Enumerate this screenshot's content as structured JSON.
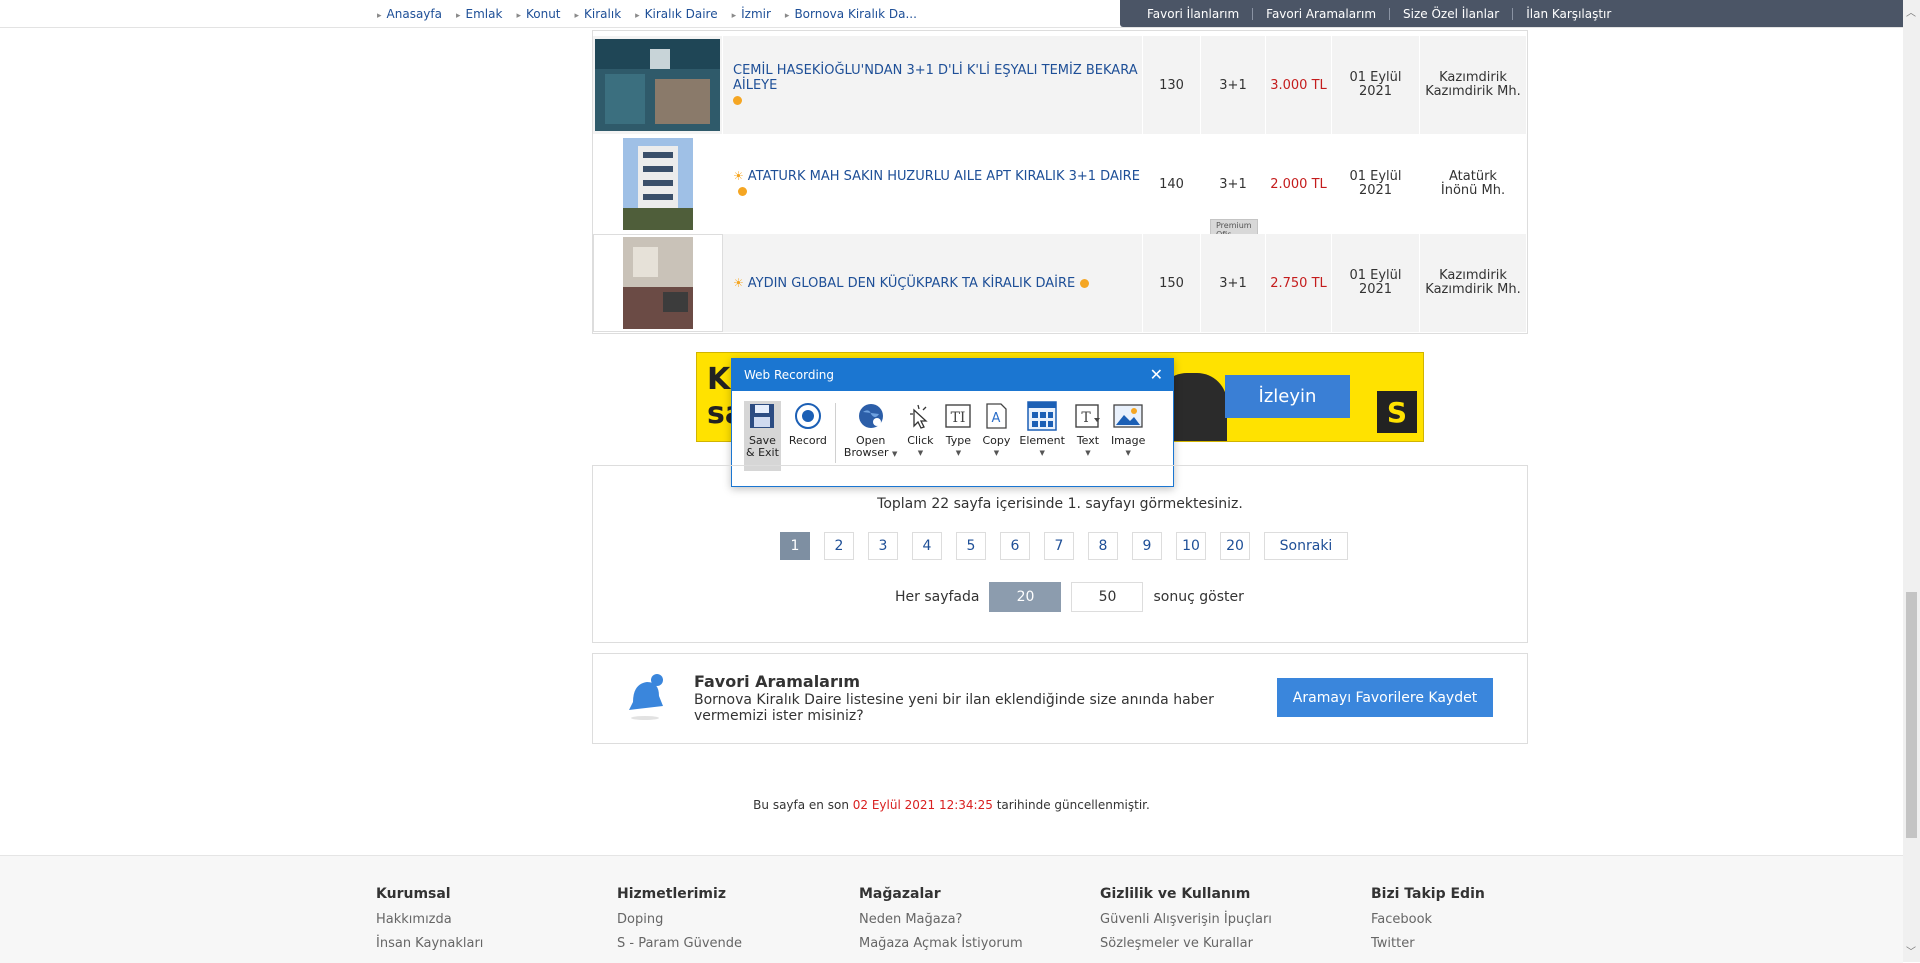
{
  "breadcrumbs": [
    "Anasayfa",
    "Emlak",
    "Konut",
    "Kiralık",
    "Kiralık Daire",
    "İzmir",
    "Bornova Kiralık Da..."
  ],
  "top_links": [
    "Favori İlanlarım",
    "Favori Aramalarım",
    "Size Özel İlanlar",
    "İlan Karşılaştır"
  ],
  "listings": [
    {
      "title": "CEMİL HASEKİOĞLU'NDAN 3+1 D'Lİ K'Lİ EŞYALI TEMİZ BEKARA AİLEYE",
      "m2": "130",
      "rooms": "3+1",
      "price": "3.000 TL",
      "date_line1": "01 Eylül",
      "date_line2": "2021",
      "loc_line1": "Kazımdirik",
      "loc_line2": "Kazımdirik Mh."
    },
    {
      "title": "ATATURK MAH SAKIN HUZURLU AILE APT KIRALIK 3+1 DAIRE",
      "m2": "140",
      "rooms": "3+1",
      "price": "2.000 TL",
      "date_line1": "01 Eylül",
      "date_line2": "2021",
      "loc_line1": "Atatürk",
      "loc_line2": "İnönü Mh.",
      "badge": "Premium Ofis"
    },
    {
      "title": "AYDIN GLOBAL DEN KÜÇÜKPARK TA KİRALIK DAİRE",
      "m2": "150",
      "rooms": "3+1",
      "price": "2.750 TL",
      "date_line1": "01 Eylül",
      "date_line2": "2021",
      "loc_line1": "Kazımdirik",
      "loc_line2": "Kazımdirik Mh."
    }
  ],
  "ad": {
    "text_line1": "Ki",
    "text_line2": "sa",
    "button": "İzleyin",
    "logo": "S"
  },
  "web_recording": {
    "title": "Web Recording",
    "tools": [
      {
        "line1": "Save",
        "line2": "& Exit"
      },
      {
        "line1": "Record",
        "line2": ""
      },
      {
        "line1": "Open",
        "line2": "Browser"
      },
      {
        "line1": "Click",
        "line2": ""
      },
      {
        "line1": "Type",
        "line2": ""
      },
      {
        "line1": "Copy",
        "line2": ""
      },
      {
        "line1": "Element",
        "line2": ""
      },
      {
        "line1": "Text",
        "line2": ""
      },
      {
        "line1": "Image",
        "line2": ""
      }
    ]
  },
  "pagination": {
    "info": "Toplam 22 sayfa içerisinde 1. sayfayı görmektesiniz.",
    "pages": [
      "1",
      "2",
      "3",
      "4",
      "5",
      "6",
      "7",
      "8",
      "9",
      "10",
      "20"
    ],
    "next": "Sonraki",
    "per_page_label": "Her sayfada",
    "per_page_options": [
      "20",
      "50"
    ],
    "per_page_tail": "sonuç göster"
  },
  "favorite_search": {
    "title": "Favori Aramalarım",
    "description": "Bornova Kiralık Daire listesine yeni bir ilan eklendiğinde size anında haber vermemizi ister misiniz?",
    "button": "Aramayı Favorilere Kaydet"
  },
  "updated": {
    "prefix": "Bu sayfa en son",
    "datetime": "02 Eylül 2021 12:34:25",
    "suffix": "tarihinde güncellenmiştir."
  },
  "footer": [
    {
      "heading": "Kurumsal",
      "links": [
        "Hakkımızda",
        "İnsan Kaynakları"
      ]
    },
    {
      "heading": "Hizmetlerimiz",
      "links": [
        "Doping",
        "S - Param Güvende"
      ]
    },
    {
      "heading": "Mağazalar",
      "links": [
        "Neden Mağaza?",
        "Mağaza Açmak İstiyorum"
      ]
    },
    {
      "heading": "Gizlilik ve Kullanım",
      "links": [
        "Güvenli Alışverişin İpuçları",
        "Sözleşmeler ve Kurallar"
      ]
    },
    {
      "heading": "Bizi Takip Edin",
      "links": [
        "Facebook",
        "Twitter"
      ]
    }
  ]
}
